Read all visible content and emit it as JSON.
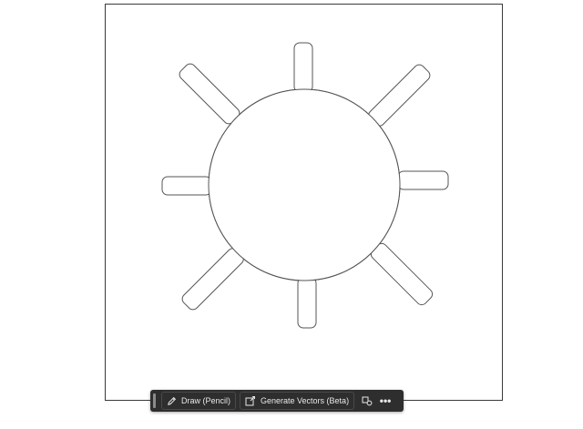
{
  "canvas": {
    "artboard_label": "",
    "artwork": "sun-outline"
  },
  "toolbar": {
    "draw_label": "Draw (Pencil)",
    "generate_label": "Generate Vectors (Beta)",
    "more_label": "•••"
  },
  "colors": {
    "toolbar_bg": "#2e2e2e",
    "toolbar_text": "#e8e8e8",
    "stroke": "#3a3a3a"
  }
}
